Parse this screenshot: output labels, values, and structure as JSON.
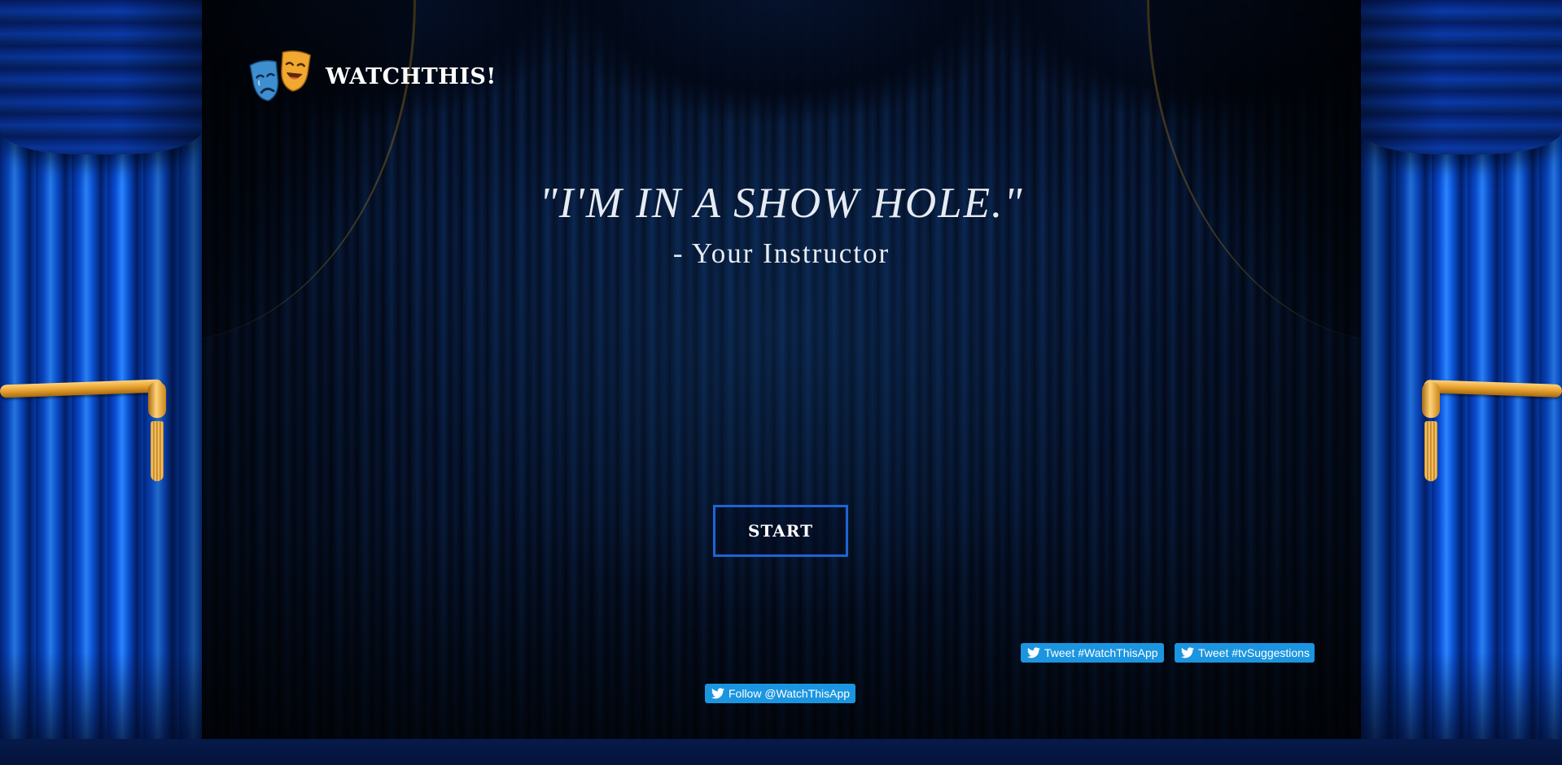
{
  "header": {
    "logo_icon": "theater-masks-icon",
    "app_name": "WATCHTHIS!"
  },
  "hero": {
    "quote": "\"I'M IN A SHOW HOLE.\"",
    "attribution": "- Your Instructor"
  },
  "actions": {
    "start_label": "START"
  },
  "social": {
    "tweet_watchthisapp": "Tweet #WatchThisApp",
    "tweet_tvsuggestions": "Tweet #tvSuggestions",
    "follow": "Follow @WatchThisApp",
    "icon": "twitter-bird-icon"
  },
  "colors": {
    "accent_blue": "#1f64d2",
    "twitter_blue": "#1b95e0",
    "curtain_blue": "#0a4fd6",
    "gold": "#e7a12e",
    "mask_sad": "#3e8fd0",
    "mask_happy": "#f0a830"
  }
}
